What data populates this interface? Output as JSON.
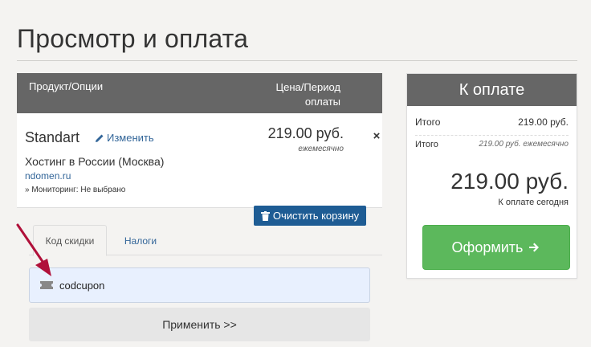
{
  "page": {
    "title": "Просмотр и оплата"
  },
  "cart": {
    "header": {
      "product": "Продукт/Опции",
      "price_line1": "Цена/Период",
      "price_line2": "оплаты"
    },
    "item": {
      "name": "Standart",
      "edit": "Изменить",
      "group": "Хостинг в России (Москва)",
      "domain": "ndomen.ru",
      "option": "» Мониторинг: Не выбрано",
      "price": "219.00 руб.",
      "cycle": "ежемесячно",
      "remove": "×"
    },
    "empty_cart": "Очистить корзину"
  },
  "tabs": {
    "promo": "Код скидки",
    "taxes": "Налоги"
  },
  "coupon": {
    "value": "codcupon",
    "apply": "Применить >>"
  },
  "summary": {
    "title": "К оплате",
    "subtotal_label": "Итого",
    "subtotal_value": "219.00 руб.",
    "recurring_label": "Итого",
    "recurring_value": "219.00 руб. ежемесячно",
    "total": "219.00 руб.",
    "due_today": "К оплате сегодня",
    "checkout": "Оформить"
  },
  "colors": {
    "header_bg": "#666666",
    "accent_blue": "#1e5c94",
    "checkout_green": "#5cb85c",
    "arrow": "#b0103a"
  }
}
